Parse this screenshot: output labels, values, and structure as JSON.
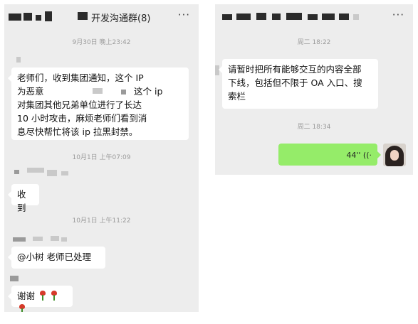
{
  "left_chat": {
    "title": "开发沟通群(8)",
    "more": "···",
    "messages": [
      {
        "time": "9月30日 晚上23:42",
        "text_lines": [
          "老师们，收到集团通知，这个 IP",
          "为恶意",
          "这个 ip",
          "对集团其他兄弟单位进行了长达",
          "10 小时攻击，麻烦老师们看到消",
          "息尽快帮忙将该 ip 拉黑封禁。"
        ]
      },
      {
        "time": "10月1日 上午07:09",
        "text": "收到"
      },
      {
        "time": "10月1日 上午11:22",
        "text": "@小树   老师已处理"
      },
      {
        "text": "谢谢"
      }
    ]
  },
  "right_chat": {
    "more": "···",
    "messages": [
      {
        "time": "周二 18:22",
        "text_lines": [
          "请暂时把所有能够交互的内容全部",
          "下线，包括但不限于 OA 入口、搜",
          "索栏"
        ]
      },
      {
        "time": "周二 18:34",
        "voice_duration": "44'' ((·"
      }
    ]
  },
  "colors": {
    "background": "#ededed",
    "bubble_in": "#ffffff",
    "bubble_out": "#95ec69",
    "timestamp": "#9b9b9b"
  },
  "icons": [
    "more-icon",
    "rose-icon",
    "voice-wave-icon",
    "avatar"
  ]
}
